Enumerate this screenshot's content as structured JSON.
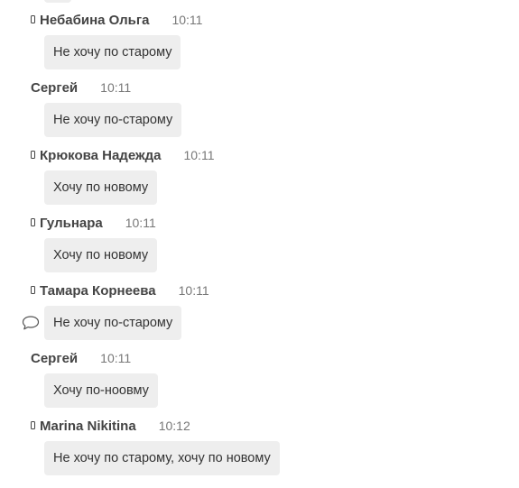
{
  "messages": [
    {
      "author": "Небабина Ольга",
      "time": "10:11",
      "text": "Не хочу по старому",
      "device": "phone-icon"
    },
    {
      "author": "Сергей",
      "time": "10:11",
      "text": "Не хочу по-старому",
      "device": ""
    },
    {
      "author": "Крюкова Надежда",
      "time": "10:11",
      "text": "Хочу по новому",
      "device": "phone-icon"
    },
    {
      "author": "Гульнара",
      "time": "10:11",
      "text": "Хочу по новому",
      "device": "phone-icon"
    },
    {
      "author": "Тамара Корнеева",
      "time": "10:11",
      "text": "Не хочу по-старому",
      "device": "phone-icon",
      "hover_icon": "comment-icon"
    },
    {
      "author": "Сергей",
      "time": "10:11",
      "text": "Хочу по-ноовму",
      "device": ""
    },
    {
      "author": "Marina Nikitina",
      "time": "10:12",
      "text": "Не хочу по старому, хочу по новому",
      "device": "phone-icon"
    }
  ],
  "colors": {
    "bubble_bg": "#eeeeee",
    "author_text": "#444444",
    "time_text": "#777777",
    "message_text": "#333333"
  }
}
